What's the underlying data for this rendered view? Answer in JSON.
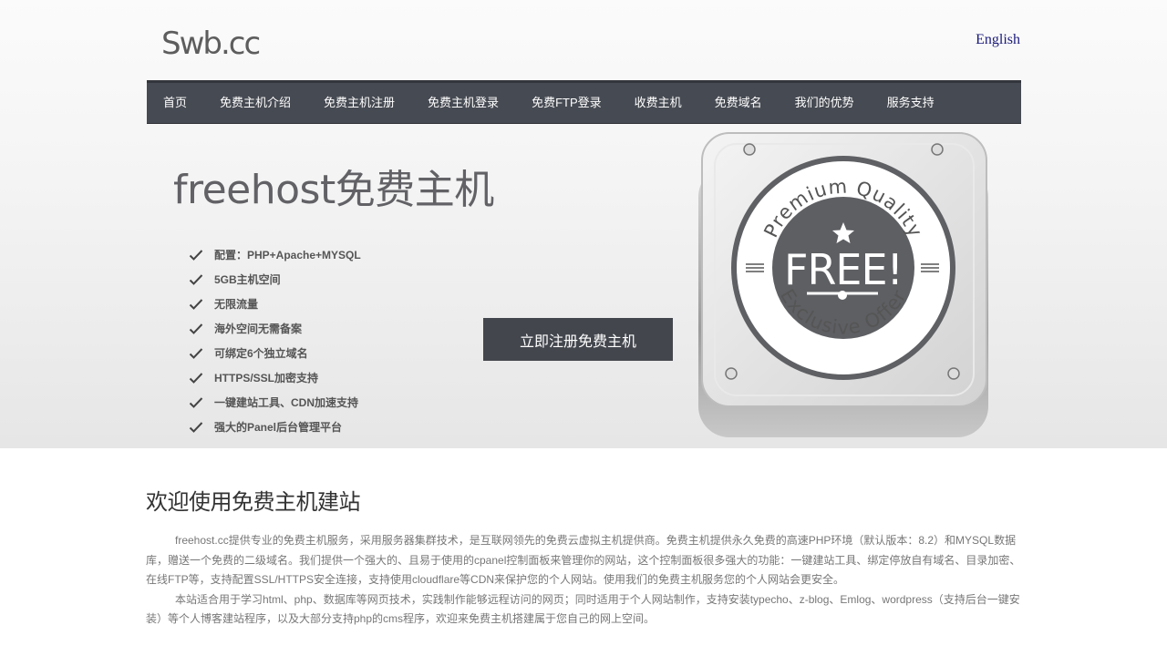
{
  "header": {
    "logo_text": "Swb.cc",
    "language_link": "English"
  },
  "nav": {
    "items": [
      {
        "label": "首页"
      },
      {
        "label": "免费主机介绍"
      },
      {
        "label": "免费主机注册"
      },
      {
        "label": "免费主机登录"
      },
      {
        "label": "免费FTP登录"
      },
      {
        "label": "收费主机"
      },
      {
        "label": "免费域名"
      },
      {
        "label": "我们的优势"
      },
      {
        "label": "服务支持"
      }
    ]
  },
  "hero": {
    "title": "freehost免费主机",
    "features": [
      "配置：PHP+Apache+MYSQL",
      "5GB主机空间",
      "无限流量",
      "海外空间无需备案",
      "可绑定6个独立域名",
      "HTTPS/SSL加密支持",
      "一键建站工具、CDN加速支持",
      "强大的Panel后台管理平台"
    ],
    "register_button": "立即注册免费主机",
    "badge": {
      "top_arc": "Premium Quality",
      "center": "FREE!",
      "bottom_arc": "Exclusive Offer"
    }
  },
  "content": {
    "welcome_title": "欢迎使用免费主机建站",
    "paragraphs": [
      "freehost.cc提供专业的免费主机服务，采用服务器集群技术，是互联网领先的免费云虚拟主机提供商。免费主机提供永久免费的高速PHP环境（默认版本：8.2）和MYSQL数据库，赠送一个免费的二级域名。我们提供一个强大的、且易于使用的cpanel控制面板来管理你的网站，这个控制面板很多强大的功能：一键建站工具、绑定停放自有域名、目录加密、在线FTP等，支持配置SSL/HTTPS安全连接，支持使用cloudflare等CDN来保护您的个人网站。使用我们的免费主机服务您的个人网站会更安全。",
      "本站适合用于学习html、php、数据库等网页技术，实践制作能够远程访问的网页；同时适用于个人网站制作，支持安装typecho、z-blog、Emlog、wordpress（支持后台一键安装）等个人博客建站程序，以及大部分支持php的cms程序，欢迎来免费主机搭建属于您自己的网上空间。"
    ]
  },
  "colors": {
    "nav_bg": "#464a52",
    "button_bg": "#43464d",
    "title_text": "#626266"
  }
}
